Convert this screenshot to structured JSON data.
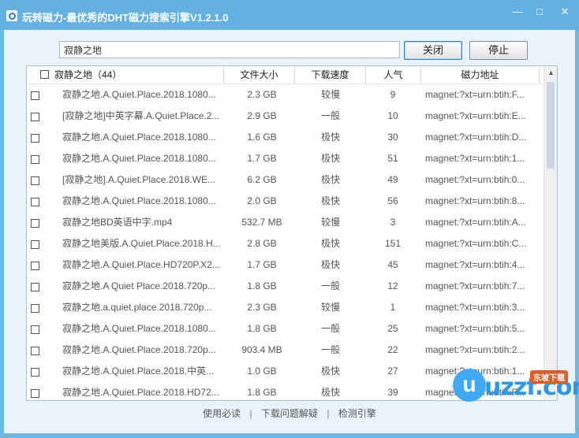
{
  "window": {
    "title": "玩转磁力-最优秀的DHT磁力搜索引擎V1.2.1.0",
    "controls": {
      "minimize": "—",
      "maximize": "□",
      "close": "✕"
    }
  },
  "search": {
    "value": "寂静之地",
    "placeholder": ""
  },
  "buttons": {
    "close_label": "关闭",
    "stop_label": "停止"
  },
  "table": {
    "headers": {
      "name": "寂静之地（44）",
      "size": "文件大小",
      "speed": "下载速度",
      "popularity": "人气",
      "magnet": "磁力地址"
    },
    "rows": [
      {
        "name": "寂静之地.A.Quiet.Place.2018.1080...",
        "size": "2.3 GB",
        "speed": "较慢",
        "pop": "9",
        "magnet": "magnet:?xt=urn:btih:F..."
      },
      {
        "name": "[寂静之地]中英字幕.A.Quiet.Place.2...",
        "size": "2.9 GB",
        "speed": "一般",
        "pop": "10",
        "magnet": "magnet:?xt=urn:btih:E..."
      },
      {
        "name": "寂静之地.A.Quiet.Place.2018.1080...",
        "size": "1.6 GB",
        "speed": "极快",
        "pop": "30",
        "magnet": "magnet:?xt=urn:btih:D..."
      },
      {
        "name": "寂静之地.A.Quiet.Place.2018.1080...",
        "size": "1.7 GB",
        "speed": "极快",
        "pop": "51",
        "magnet": "magnet:?xt=urn:btih:1..."
      },
      {
        "name": "[寂静之地].A.Quiet.Place.2018.WE...",
        "size": "6.2 GB",
        "speed": "极快",
        "pop": "49",
        "magnet": "magnet:?xt=urn:btih:0..."
      },
      {
        "name": "寂静之地.A.Quiet.Place.2018.1080...",
        "size": "2.0 GB",
        "speed": "极快",
        "pop": "56",
        "magnet": "magnet:?xt=urn:btih:8..."
      },
      {
        "name": "寂静之地BD英语中字.mp4",
        "size": "532.7 MB",
        "speed": "较慢",
        "pop": "3",
        "magnet": "magnet:?xt=urn:btih:A..."
      },
      {
        "name": "寂静之地美版.A.Quiet.Place.2018.H...",
        "size": "2.8 GB",
        "speed": "极快",
        "pop": "151",
        "magnet": "magnet:?xt=urn:btih:C..."
      },
      {
        "name": "寂静之地.A.Quiet.Place.HD720P.X2...",
        "size": "1.7 GB",
        "speed": "极快",
        "pop": "45",
        "magnet": "magnet:?xt=urn:btih:4..."
      },
      {
        "name": "寂静之地.A Quiet Place.2018.720p...",
        "size": "1.8 GB",
        "speed": "一般",
        "pop": "12",
        "magnet": "magnet:?xt=urn:btih:7..."
      },
      {
        "name": "寂静之地.a.quiet.place.2018.720p...",
        "size": "2.3 GB",
        "speed": "较慢",
        "pop": "1",
        "magnet": "magnet:?xt=urn:btih:3..."
      },
      {
        "name": "寂静之地.A.Quiet.Place.2018.1080...",
        "size": "1.8 GB",
        "speed": "一般",
        "pop": "25",
        "magnet": "magnet:?xt=urn:btih:5..."
      },
      {
        "name": "寂静之地.A.Quiet.Place.2018.720p...",
        "size": "903.4 MB",
        "speed": "一般",
        "pop": "22",
        "magnet": "magnet:?xt=urn:btih:2..."
      },
      {
        "name": "寂静之地.A.Quiet.Place.2018.中英...",
        "size": "1.0 GB",
        "speed": "极快",
        "pop": "27",
        "magnet": "magnet:?xt=urn:btih:1..."
      },
      {
        "name": "寂静之地.A.Quiet.Place.2018.HD72...",
        "size": "1.8 GB",
        "speed": "极快",
        "pop": "39",
        "magnet": "magnet:?xt=urn:btih:F..."
      }
    ]
  },
  "footer": {
    "links": [
      "使用必读",
      "下载问题解疑",
      "检测引擎"
    ],
    "separator": "|"
  },
  "watermark": {
    "brand": "uzzf.com",
    "badge": "东坡下载",
    "letter": "u"
  },
  "colors": {
    "titlebar": "#63b1e2",
    "client_bg": "#eaf2fb"
  }
}
